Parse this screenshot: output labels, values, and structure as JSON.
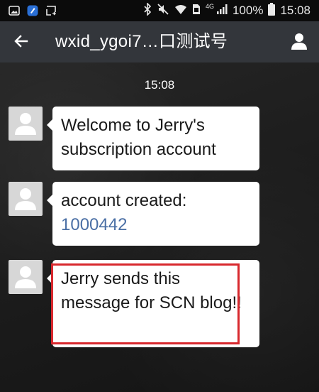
{
  "status_bar": {
    "network": "4G",
    "battery": "100%",
    "time": "15:08",
    "icons": [
      "gallery-icon",
      "app-notification-icon",
      "cast-icon",
      "bluetooth-icon",
      "mute-icon",
      "wifi-icon",
      "sim-icon",
      "signal-icon",
      "battery-icon"
    ]
  },
  "header": {
    "title": "wxid_ygoi7…口测试号",
    "back_icon": "arrow-left-icon",
    "profile_icon": "person-icon"
  },
  "chat": {
    "timestamp": "15:08",
    "messages": [
      {
        "text": "Welcome to Jerry's subscription account",
        "link": ""
      },
      {
        "text": "account created:",
        "link": "1000442"
      },
      {
        "text": "Jerry sends this message for SCN blog!!",
        "link": ""
      }
    ]
  },
  "colors": {
    "header_bg": "#33363b",
    "status_bg": "#0b0b0b",
    "bubble_bg": "#ffffff",
    "link": "#4a6fa5",
    "highlight": "#d8282d"
  }
}
